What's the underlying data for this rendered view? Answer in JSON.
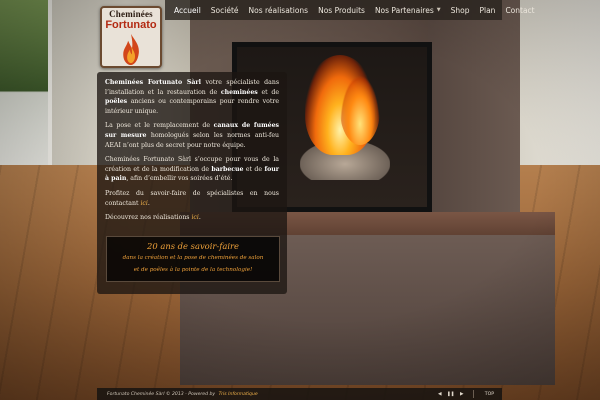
{
  "brand": {
    "logo_line1": "Cheminées",
    "logo_line2": "Fortunato"
  },
  "nav": {
    "items": [
      {
        "label": "Accueil"
      },
      {
        "label": "Société"
      },
      {
        "label": "Nos réalisations"
      },
      {
        "label": "Nos Produits"
      },
      {
        "label": "Nos Partenaires"
      },
      {
        "label": "Shop"
      },
      {
        "label": "Plan"
      },
      {
        "label": "Contact"
      }
    ],
    "dropdown_caret": "▼"
  },
  "content": {
    "p1_b1": "Cheminées Fortunato Sàrl",
    "p1_t1": " votre spécialiste dans l’installation et la restauration de ",
    "p1_b2": "cheminées",
    "p1_t2": " et de ",
    "p1_b3": "poêles",
    "p1_t3": " anciens ou contemporains pour rendre votre intérieur unique.",
    "p2_t1": "La pose et le remplacement de ",
    "p2_b1": "canaux de fumées sur mesure",
    "p2_t2": " homologués selon les normes anti-feu AEAI n’ont plus de secret pour notre équipe.",
    "p3_t1": "Cheminées Fortunato Sàrl s’occupe pour vous de la création et de la modification de ",
    "p3_b1": "barbecue",
    "p3_t2": " et de ",
    "p3_b2": "four à pain",
    "p3_t3": ", afin d’embellir vos soirées d’été.",
    "p4_t1": "Profitez du savoir-faire de spécialistes en nous contactant ",
    "p4_link": "ici",
    "p4_t2": ".",
    "p5_t1": "Découvrez nos réalisations ",
    "p5_link": "ici",
    "p5_t2": "."
  },
  "promo": {
    "title": "20 ans de savoir-faire",
    "line1": "dans la création et la pose de cheminées de salon",
    "line2": "et de poêles à la pointe de la technologie!"
  },
  "footer": {
    "text": "Fortunato Cheminée Sàrl © 2013 - Powered by",
    "link": "Tris Informatique",
    "controls": {
      "prev": "◀",
      "pause": "❚❚",
      "next": "▶",
      "top": "TOP"
    }
  },
  "colors": {
    "accent": "#f0b24a",
    "promo_text": "#f0a23a",
    "panel_bg": "#1c1612",
    "logo_red": "#b32a12"
  },
  "icons": {
    "logo": "flame-logo-icon",
    "caret": "chevron-down-icon",
    "prev": "prev-slide-icon",
    "pause": "pause-icon",
    "next": "next-slide-icon"
  }
}
